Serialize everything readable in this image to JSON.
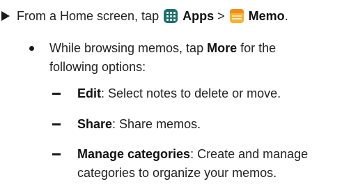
{
  "step": {
    "prefix": "From a Home screen, tap",
    "apps_label": "Apps",
    "separator": ">",
    "memo_label": "Memo",
    "period": ".",
    "apps_icon": "apps-grid-icon",
    "memo_icon": "memo-notepad-icon"
  },
  "bullet": {
    "line1_prefix": "While browsing memos, tap",
    "more_label": "More",
    "line1_suffix": "for the",
    "line2": "following options:"
  },
  "options": [
    {
      "name": "Edit",
      "desc": ": Select notes to delete or move."
    },
    {
      "name": "Share",
      "desc": ": Share memos."
    },
    {
      "name": "Manage categories",
      "desc": ": Create and manage",
      "desc2": "categories to organize your memos."
    }
  ],
  "colors": {
    "apps_icon": "#1e6f6c",
    "memo_icon": "#f7b233"
  }
}
